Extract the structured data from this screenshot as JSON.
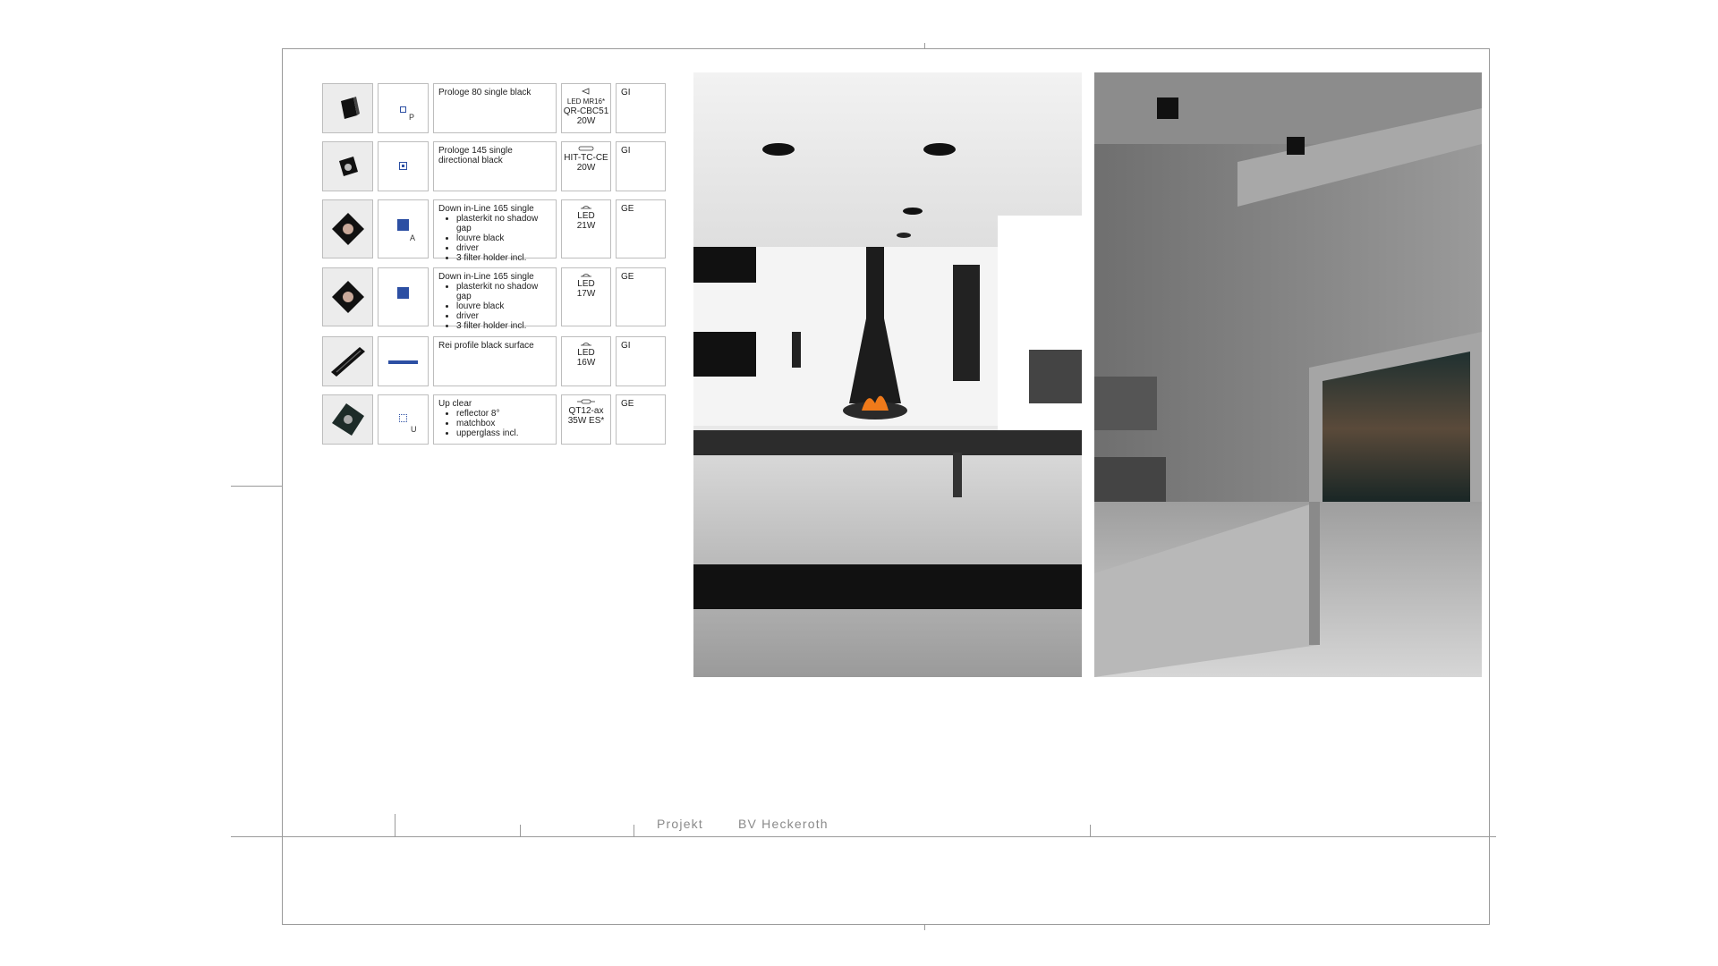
{
  "title_block": {
    "label": "Projekt",
    "value": "BV Heckeroth"
  },
  "rows": [
    {
      "description": "Prologe 80 single black",
      "bullets": [],
      "lamp_note": "LED MR16*",
      "lamp_type": "QR-CBC51",
      "power": "20W",
      "code": "GI",
      "symbol": "small-square-outline",
      "symbol_label": "P",
      "icon": "cube-spot-icon"
    },
    {
      "description": "Prologe 145 single directional black",
      "bullets": [],
      "lamp_note": "",
      "lamp_type": "HIT-TC-CE",
      "power": "20W",
      "code": "GI",
      "symbol": "square-with-dot",
      "symbol_label": "",
      "icon": "cube-directional-icon"
    },
    {
      "description": "Down in-Line 165 single",
      "bullets": [
        "plasterkit no shadow gap",
        "louvre black",
        "driver",
        "3 filter holder incl."
      ],
      "lamp_note": "",
      "lamp_type": "LED",
      "power": "21W",
      "code": "GE",
      "symbol": "filled-square",
      "symbol_label": "A",
      "icon": "recessed-square-icon"
    },
    {
      "description": "Down in-Line 165 single",
      "bullets": [
        "plasterkit no shadow gap",
        "louvre black",
        "driver",
        "3 filter holder incl."
      ],
      "lamp_note": "",
      "lamp_type": "LED",
      "power": "17W",
      "code": "GE",
      "symbol": "filled-square",
      "symbol_label": "",
      "icon": "recessed-square-icon"
    },
    {
      "description": "Rei profile black surface",
      "bullets": [],
      "lamp_note": "",
      "lamp_type": "LED",
      "power": "16W",
      "code": "GI",
      "symbol": "line",
      "symbol_label": "",
      "icon": "linear-profile-icon"
    },
    {
      "description": "Up clear",
      "bullets": [
        "reflector 8°",
        "matchbox",
        "upperglass incl."
      ],
      "lamp_note": "",
      "lamp_type": "QT12-ax",
      "power": "35W ES*",
      "code": "GE",
      "symbol": "dotted-square-outline",
      "symbol_label": "U",
      "icon": "uplight-square-icon"
    }
  ],
  "colors": {
    "accent_blue": "#2c4fa3",
    "frame_line": "#9a9a9a",
    "cell_border": "#bdbdbd"
  }
}
